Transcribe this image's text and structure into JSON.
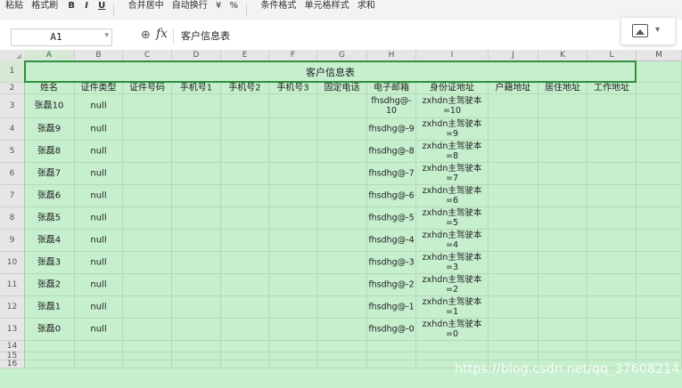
{
  "ribbon": {
    "items": [
      "粘贴",
      "格式刷",
      "B",
      "I",
      "U",
      "合并居中",
      "自动换行",
      "¥",
      "%",
      "条件格式",
      "单元格样式",
      "求和"
    ]
  },
  "formula_bar": {
    "name_box": "A1",
    "fx": "fx",
    "content": "客户信息表"
  },
  "columns": [
    "A",
    "B",
    "C",
    "D",
    "E",
    "F",
    "G",
    "H",
    "I",
    "J",
    "K",
    "L",
    "M"
  ],
  "rows": [
    "1",
    "2",
    "3",
    "4",
    "5",
    "6",
    "7",
    "8",
    "9",
    "10",
    "11",
    "12",
    "13",
    "14",
    "15",
    "16"
  ],
  "sheet": {
    "title": "客户信息表",
    "headers": [
      "姓名",
      "证件类型",
      "证件号码",
      "手机号1",
      "手机号2",
      "手机号3",
      "固定电话",
      "电子邮箱",
      "身份证地址",
      "户籍地址",
      "居住地址",
      "工作地址"
    ],
    "records": [
      {
        "name": "张磊10",
        "type": "null",
        "email": "fhsdhg@-\n10",
        "addr": "zxhdn主驾驶本\n=10"
      },
      {
        "name": "张磊9",
        "type": "null",
        "email": "fhsdhg@-9",
        "addr": "zxhdn主驾驶本\n=9"
      },
      {
        "name": "张磊8",
        "type": "null",
        "email": "fhsdhg@-8",
        "addr": "zxhdn主驾驶本\n=8"
      },
      {
        "name": "张磊7",
        "type": "null",
        "email": "fhsdhg@-7",
        "addr": "zxhdn主驾驶本\n=7"
      },
      {
        "name": "张磊6",
        "type": "null",
        "email": "fhsdhg@-6",
        "addr": "zxhdn主驾驶本\n=6"
      },
      {
        "name": "张磊5",
        "type": "null",
        "email": "fhsdhg@-5",
        "addr": "zxhdn主驾驶本\n=5"
      },
      {
        "name": "张磊4",
        "type": "null",
        "email": "fhsdhg@-4",
        "addr": "zxhdn主驾驶本\n=4"
      },
      {
        "name": "张磊3",
        "type": "null",
        "email": "fhsdhg@-3",
        "addr": "zxhdn主驾驶本\n=3"
      },
      {
        "name": "张磊2",
        "type": "null",
        "email": "fhsdhg@-2",
        "addr": "zxhdn主驾驶本\n=2"
      },
      {
        "name": "张磊1",
        "type": "null",
        "email": "fhsdhg@-1",
        "addr": "zxhdn主驾驶本\n=1"
      },
      {
        "name": "张磊0",
        "type": "null",
        "email": "fhsdhg@-0",
        "addr": "zxhdn主驾驶本\n=0"
      }
    ]
  },
  "watermark": "https://blog.csdn.net/qq_37608214",
  "colors": {
    "fill": "#c6efce",
    "selection_border": "#2f8f3f"
  }
}
